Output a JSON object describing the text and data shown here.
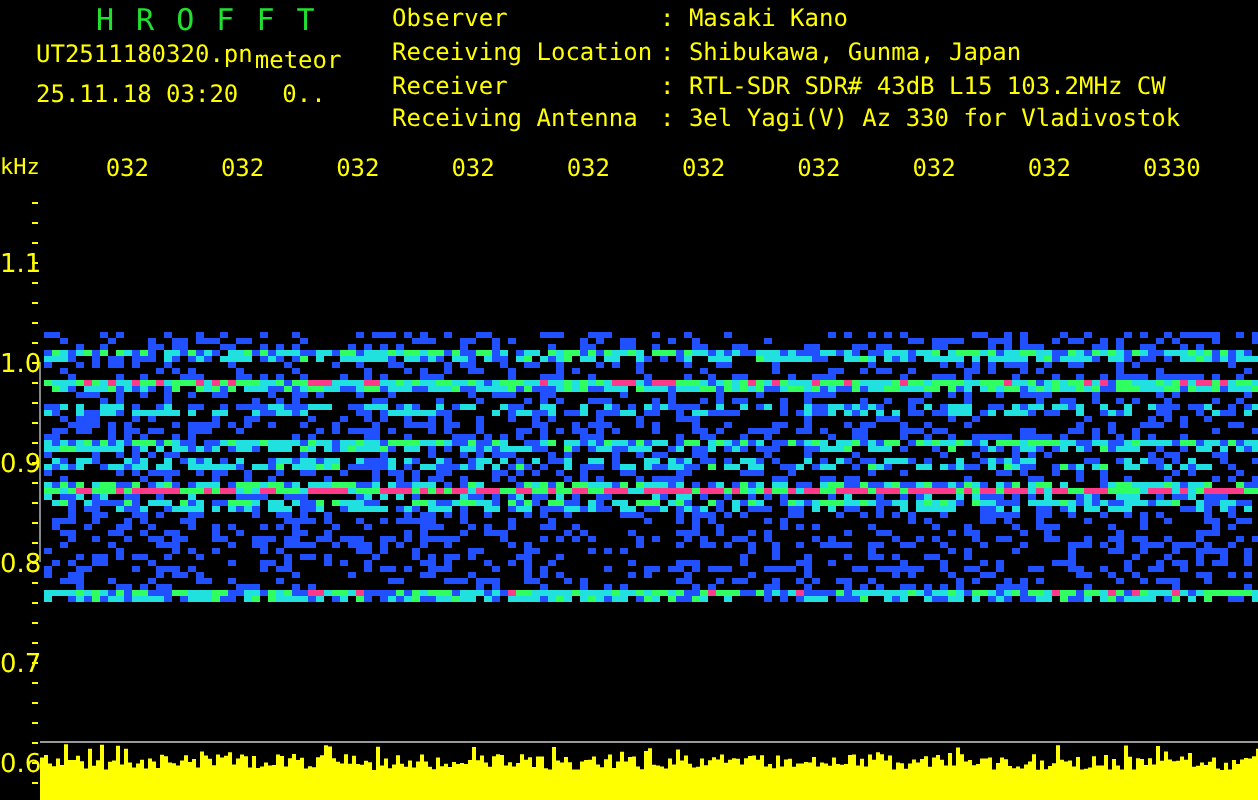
{
  "app_title": "H R O F F T",
  "file": {
    "name": "UT2511180320.pn",
    "tag": "meteor",
    "datetime": "25.11.18 03:20",
    "value": "0.."
  },
  "info": [
    {
      "label": "Observer",
      "value": ": Masaki Kano"
    },
    {
      "label": "Receiving Location",
      "value": ": Shibukawa, Gunma, Japan"
    },
    {
      "label": "Receiver",
      "value": ": RTL-SDR SDR# 43dB L15 103.2MHz CW"
    },
    {
      "label": "Receiving Antenna",
      "value": ": 3el Yagi(V) Az 330 for Vladivostok"
    }
  ],
  "y_unit": "kHz",
  "time_labels": [
    "032",
    "032",
    "032",
    "032",
    "032",
    "032",
    "032",
    "032",
    "032",
    "0330"
  ],
  "y_labels": [
    "1.1",
    "1.0",
    "0.9",
    "0.8",
    "0.7",
    "0.6"
  ]
}
